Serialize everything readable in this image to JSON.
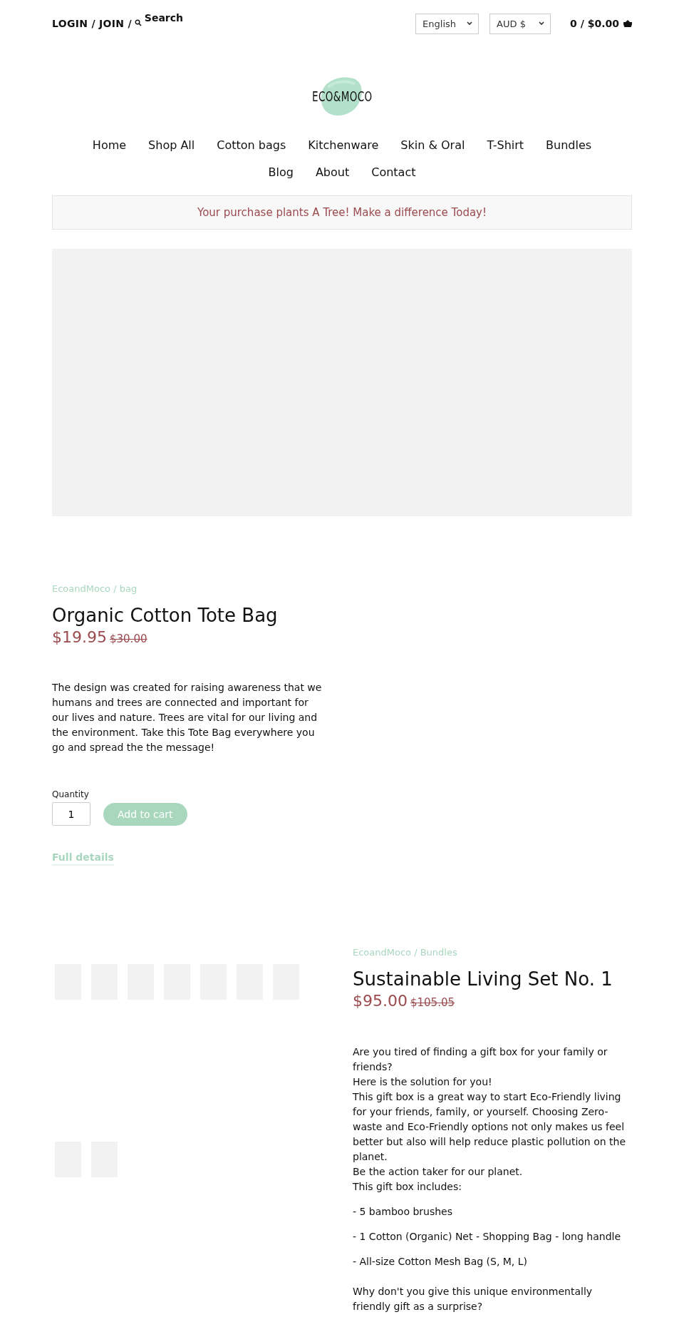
{
  "header": {
    "account_links": "LOGIN / JOIN /",
    "search_label": "Search",
    "language": "English",
    "currency": "AUD $",
    "cart": "0 / $0.00"
  },
  "logo": {
    "text": "ECO&MOCO"
  },
  "nav": [
    {
      "label": "Home"
    },
    {
      "label": "Shop All"
    },
    {
      "label": "Cotton bags"
    },
    {
      "label": "Kitchenware"
    },
    {
      "label": "Skin & Oral"
    },
    {
      "label": "T-Shirt"
    },
    {
      "label": "Bundles"
    },
    {
      "label": "Blog"
    },
    {
      "label": "About"
    },
    {
      "label": "Contact"
    }
  ],
  "banner": "Your purchase plants A Tree! Make a difference Today!",
  "products": [
    {
      "breadcrumb": "EcoandMoco / bag",
      "title": "Organic Cotton Tote Bag",
      "price": "$19.95",
      "compare_price": "$30.00",
      "description": [
        "The design was created for raising awareness that we humans and trees are connected and important for our lives and nature. Trees are vital for our living and the environment. Take this Tote Bag everywhere you go and spread the the message!"
      ],
      "quantity_label": "Quantity",
      "quantity": "1",
      "add_button": "Add to cart",
      "details_link": "Full details"
    },
    {
      "breadcrumb": "EcoandMoco / Bundles",
      "title": "Sustainable Living Set No. 1",
      "price": "$95.00",
      "compare_price": "$105.05",
      "description_lines": [
        "Are you tired of finding a gift box for your family or friends?",
        "Here is the solution for you!",
        "This gift box is a great way to start Eco-Friendly living for your friends, family, or yourself.  Choosing Zero-waste and Eco-Friendly options not only makes us feel better but also will help reduce plastic pollution on the planet.",
        "Be the action taker for our planet.",
        "This gift box includes:"
      ],
      "includes": [
        "- 5 bamboo brushes",
        "- 1 Cotton (Organic) Net - Shopping Bag - long handle",
        "- All-size Cotton Mesh Bag (S, M, L)"
      ],
      "closing": "Why don't you give this unique environmentally friendly gift as a surprise?"
    }
  ]
}
